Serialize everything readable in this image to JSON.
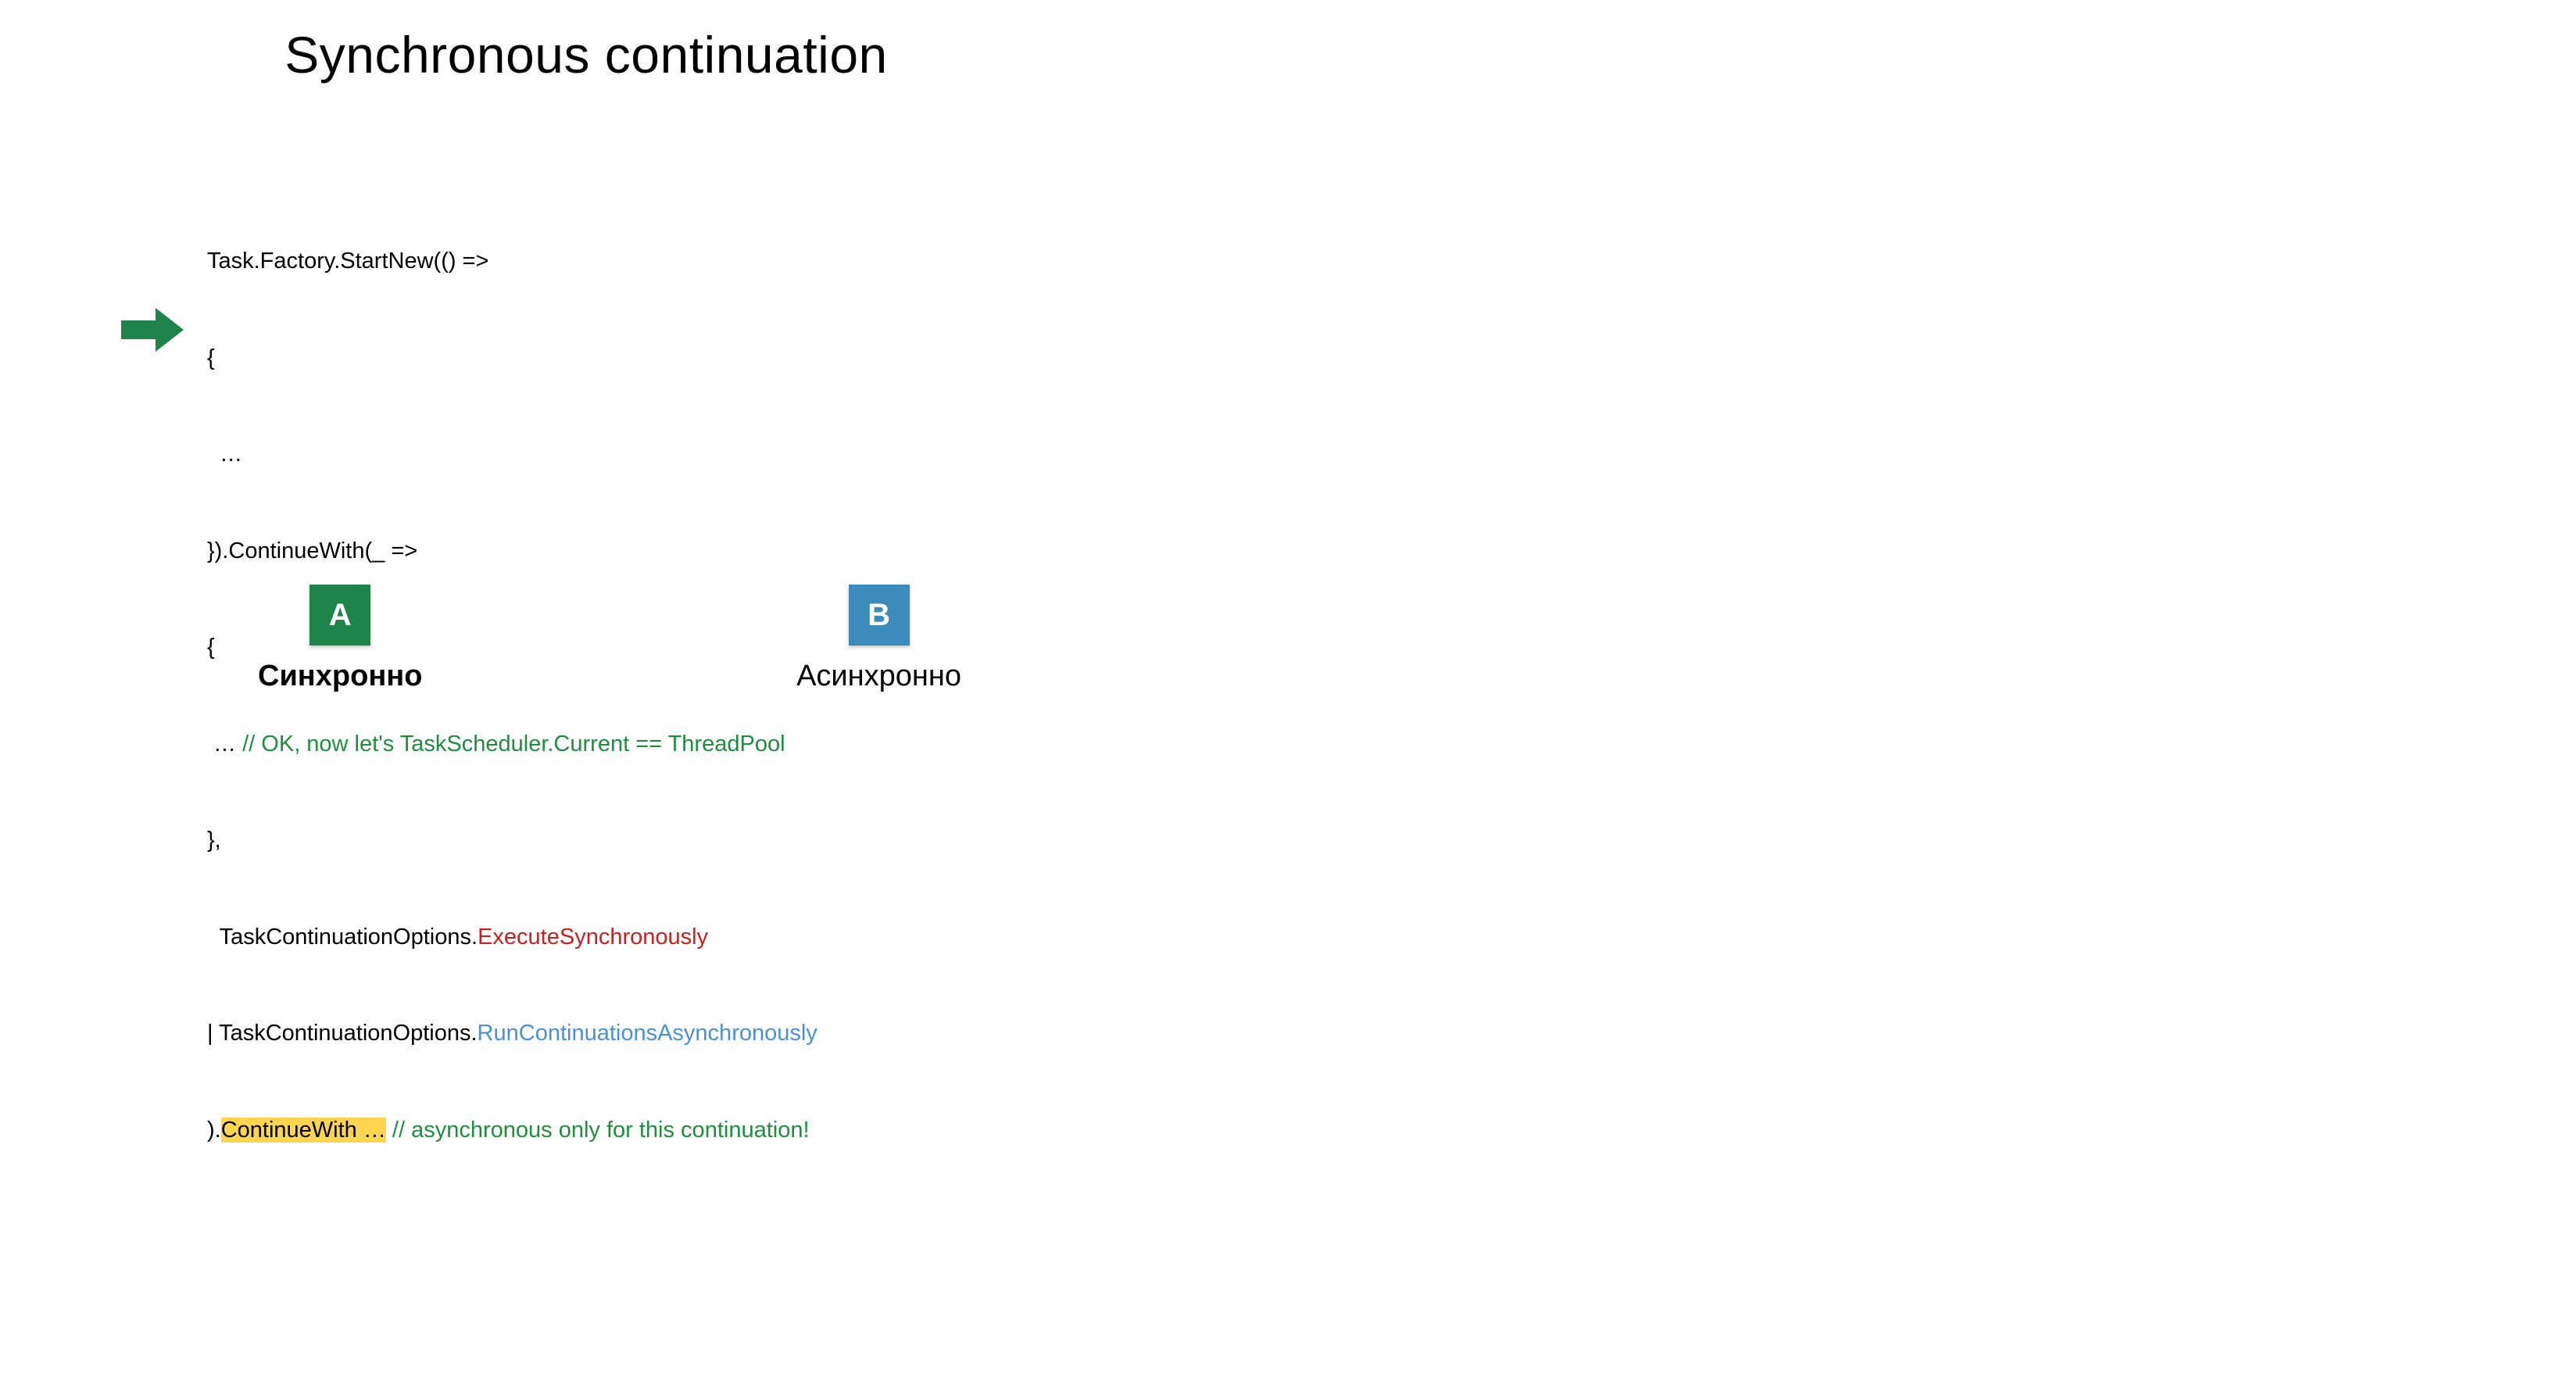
{
  "title": "Synchronous continuation",
  "code": {
    "line1": "Task.Factory.StartNew(() =>",
    "line2": "{",
    "line3": "  …",
    "line4": "}).ContinueWith(_ =>",
    "line5": "{",
    "line6_prefix": " …",
    "line6_comment": " // OK, now let's TaskScheduler.Current == ThreadPool",
    "line7": "},",
    "line8_prefix": "  TaskContinuationOptions.",
    "line8_red": "ExecuteSynchronously",
    "line9_prefix": "| TaskContinuationOptions.",
    "line9_blue": "RunContinuationsAsynchronously",
    "line10_paren": ").",
    "line10_hl": "ContinueWith …",
    "line10_comment": " // asynchronous only for this continuation!"
  },
  "options": {
    "a_badge": "A",
    "a_label": "Синхронно",
    "b_badge": "B",
    "b_label": "Асинхронно"
  },
  "colors": {
    "green": "#1e8e3e",
    "red": "#c5221f",
    "blue": "#4a90d9",
    "badgeA": "#1e8449",
    "badgeB": "#3b8cba",
    "highlight": "#ffd54f"
  }
}
